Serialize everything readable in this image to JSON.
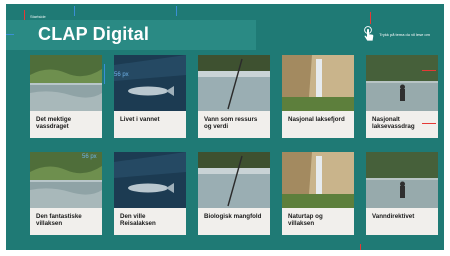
{
  "breadcrumb": "Startside",
  "title": "CLAP Digital",
  "hint": "Trykk på tema du vil lese om",
  "cards": [
    {
      "label": "Det mektige vassdraget",
      "image": "river-landscape"
    },
    {
      "label": "Livet i vannet",
      "image": "underwater-fish"
    },
    {
      "label": "Vann som ressurs og verdi",
      "image": "fishing-rod"
    },
    {
      "label": "Nasjonal laksefjord",
      "image": "waterfall-cliff"
    },
    {
      "label": "Nasjonalt laksevassdrag",
      "image": "river-angler"
    },
    {
      "label": "Den fantastiske villaksen",
      "image": "river-landscape"
    },
    {
      "label": "Den ville Reisalaksen",
      "image": "underwater-fish"
    },
    {
      "label": "Biologisk mangfold",
      "image": "fishing-rod"
    },
    {
      "label": "Naturtap og villaksen",
      "image": "waterfall-cliff"
    },
    {
      "label": "Vanndirektivet",
      "image": "river-angler"
    }
  ],
  "annotations": {
    "spacing_label": "56 px"
  },
  "colors": {
    "background": "#1f7a75",
    "card": "#f1efec",
    "guide": "#3a8fd6",
    "marker": "#e53935"
  }
}
